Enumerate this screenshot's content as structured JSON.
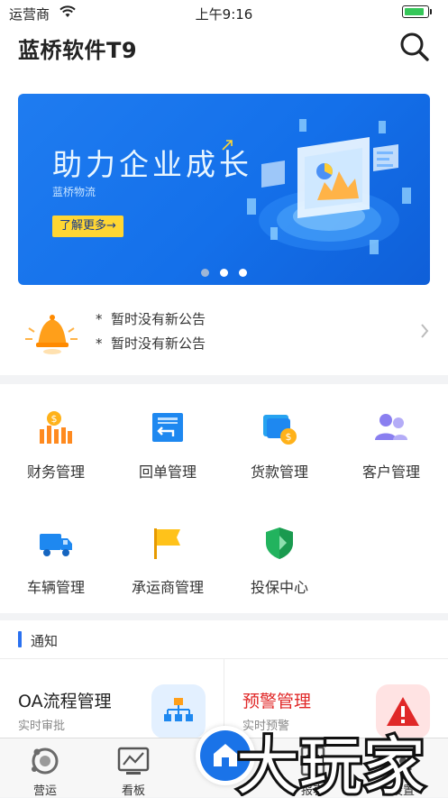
{
  "status_bar": {
    "carrier": "运营商",
    "time": "上午9:16",
    "battery_level": 0.9
  },
  "header": {
    "title": "蓝桥软件T9"
  },
  "banner": {
    "slogan": "助力企业成长",
    "subtitle": "蓝桥物流",
    "button": "了解更多→",
    "active_dot": 0,
    "dot_count": 3
  },
  "notices": [
    "暂时没有新公告",
    "暂时没有新公告"
  ],
  "notice_bullet": "*",
  "grid": [
    {
      "label": "财务管理",
      "icon": "finance-chart-icon"
    },
    {
      "label": "回单管理",
      "icon": "receipt-return-icon"
    },
    {
      "label": "货款管理",
      "icon": "wallet-coin-icon"
    },
    {
      "label": "客户管理",
      "icon": "customers-icon"
    },
    {
      "label": "车辆管理",
      "icon": "truck-icon"
    },
    {
      "label": "承运商管理",
      "icon": "flag-icon"
    },
    {
      "label": "投保中心",
      "icon": "shield-icon"
    }
  ],
  "notify": {
    "label": "通知"
  },
  "cards": [
    {
      "title": "OA流程管理",
      "subtitle": "实时审批",
      "icon": "org-chart-icon",
      "title_color": "#222222"
    },
    {
      "title": "预警管理",
      "subtitle": "实时预警",
      "icon": "warning-icon",
      "title_color": "#e02828"
    }
  ],
  "tabs": [
    {
      "label": "营运",
      "icon": "operations-icon"
    },
    {
      "label": "看板",
      "icon": "dashboard-icon"
    },
    {
      "label": "报表",
      "icon": "report-icon"
    },
    {
      "label": "设置",
      "icon": "settings-icon"
    }
  ],
  "watermark": "大玩家",
  "colors": {
    "accent": "#1a73e8",
    "banner": "#1470ea",
    "warning": "#e02828",
    "tag": "#ffd633"
  }
}
